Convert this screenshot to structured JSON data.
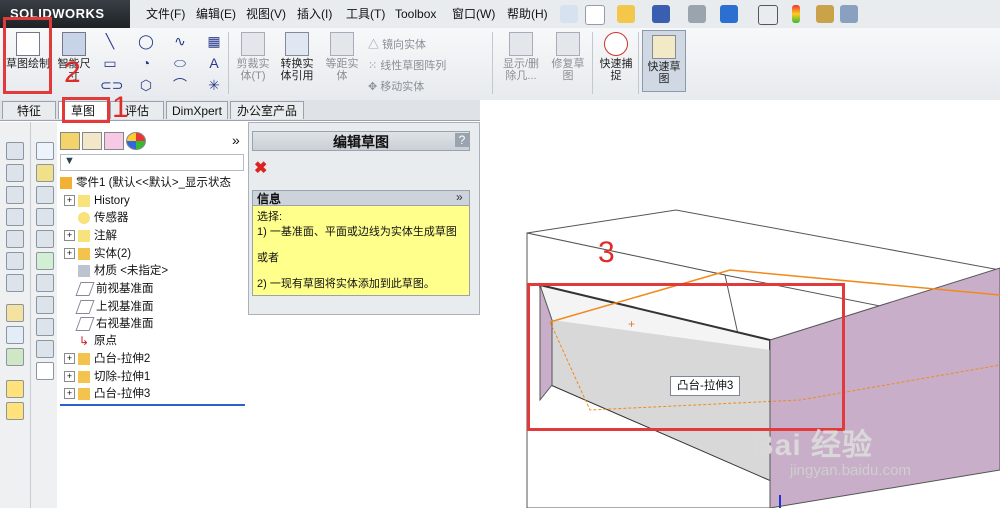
{
  "app": {
    "brand": "SOLIDWORKS"
  },
  "menus": [
    "文件(F)",
    "编辑(E)",
    "视图(V)",
    "插入(I)",
    "工具(T)",
    "Toolbox",
    "窗口(W)",
    "帮助(H)"
  ],
  "ribbon": {
    "sketch_button": "草图绘制",
    "smart_dim": "智能尺寸",
    "trim": "剪裁实体(T)",
    "convert": "转换实体引用",
    "offset": "等距实体",
    "mirror": "镜向实体",
    "linear_pattern": "线性草图阵列",
    "move": "移动实体",
    "display_delete": "显示/删除几...",
    "repair": "修复草图",
    "quick_snap": "快速捕捉",
    "rapid_sketch": "快速草图"
  },
  "tabs": [
    "特征",
    "草图",
    "评估",
    "DimXpert",
    "办公室产品"
  ],
  "tree": {
    "part": "零件1  (默认<<默认>_显示状态",
    "items": [
      "History",
      "传感器",
      "注解",
      "实体(2)",
      "材质 <未指定>",
      "前视基准面",
      "上视基准面",
      "右视基准面",
      "原点",
      "凸台-拉伸2",
      "切除-拉伸1",
      "凸台-拉伸3"
    ]
  },
  "property_manager": {
    "title": "编辑草图",
    "help": "?",
    "info_title": "信息",
    "info_lines": [
      "选择:",
      "1) 一基准面、平面或边线为实体生成草图",
      "或者",
      "2) 一现有草图将实体添加到此草图。"
    ]
  },
  "viewport": {
    "tooltip": "凸台-拉伸3"
  },
  "annotations": {
    "n1": "1",
    "n2": "2",
    "n3": "3"
  },
  "watermark": {
    "main": "Bai 经验",
    "url": "jingyan.baidu.com"
  },
  "colors": {
    "annotation": "#e02b2b",
    "face": "#c8aec8",
    "edge": "#f08a1c",
    "info_bg": "#ffff8c"
  }
}
